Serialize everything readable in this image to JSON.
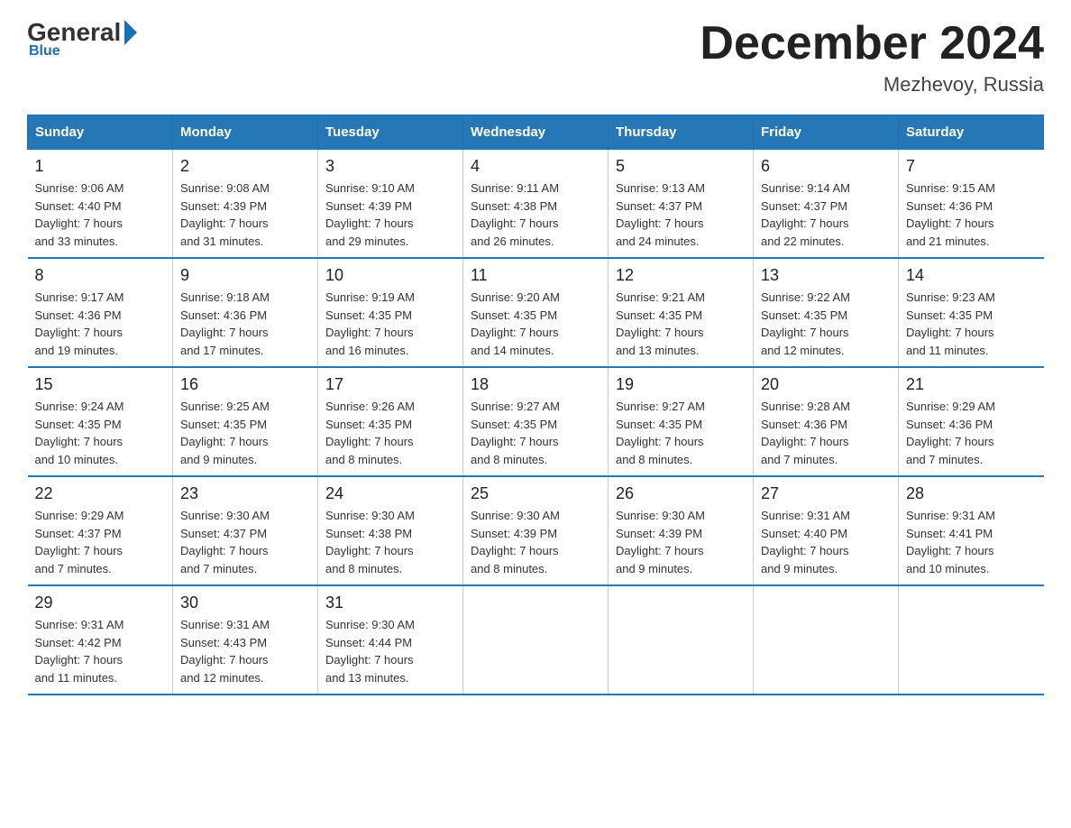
{
  "header": {
    "logo_general": "General",
    "logo_blue": "Blue",
    "title": "December 2024",
    "subtitle": "Mezhevoy, Russia"
  },
  "columns": [
    "Sunday",
    "Monday",
    "Tuesday",
    "Wednesday",
    "Thursday",
    "Friday",
    "Saturday"
  ],
  "weeks": [
    [
      {
        "day": "1",
        "info": "Sunrise: 9:06 AM\nSunset: 4:40 PM\nDaylight: 7 hours\nand 33 minutes."
      },
      {
        "day": "2",
        "info": "Sunrise: 9:08 AM\nSunset: 4:39 PM\nDaylight: 7 hours\nand 31 minutes."
      },
      {
        "day": "3",
        "info": "Sunrise: 9:10 AM\nSunset: 4:39 PM\nDaylight: 7 hours\nand 29 minutes."
      },
      {
        "day": "4",
        "info": "Sunrise: 9:11 AM\nSunset: 4:38 PM\nDaylight: 7 hours\nand 26 minutes."
      },
      {
        "day": "5",
        "info": "Sunrise: 9:13 AM\nSunset: 4:37 PM\nDaylight: 7 hours\nand 24 minutes."
      },
      {
        "day": "6",
        "info": "Sunrise: 9:14 AM\nSunset: 4:37 PM\nDaylight: 7 hours\nand 22 minutes."
      },
      {
        "day": "7",
        "info": "Sunrise: 9:15 AM\nSunset: 4:36 PM\nDaylight: 7 hours\nand 21 minutes."
      }
    ],
    [
      {
        "day": "8",
        "info": "Sunrise: 9:17 AM\nSunset: 4:36 PM\nDaylight: 7 hours\nand 19 minutes."
      },
      {
        "day": "9",
        "info": "Sunrise: 9:18 AM\nSunset: 4:36 PM\nDaylight: 7 hours\nand 17 minutes."
      },
      {
        "day": "10",
        "info": "Sunrise: 9:19 AM\nSunset: 4:35 PM\nDaylight: 7 hours\nand 16 minutes."
      },
      {
        "day": "11",
        "info": "Sunrise: 9:20 AM\nSunset: 4:35 PM\nDaylight: 7 hours\nand 14 minutes."
      },
      {
        "day": "12",
        "info": "Sunrise: 9:21 AM\nSunset: 4:35 PM\nDaylight: 7 hours\nand 13 minutes."
      },
      {
        "day": "13",
        "info": "Sunrise: 9:22 AM\nSunset: 4:35 PM\nDaylight: 7 hours\nand 12 minutes."
      },
      {
        "day": "14",
        "info": "Sunrise: 9:23 AM\nSunset: 4:35 PM\nDaylight: 7 hours\nand 11 minutes."
      }
    ],
    [
      {
        "day": "15",
        "info": "Sunrise: 9:24 AM\nSunset: 4:35 PM\nDaylight: 7 hours\nand 10 minutes."
      },
      {
        "day": "16",
        "info": "Sunrise: 9:25 AM\nSunset: 4:35 PM\nDaylight: 7 hours\nand 9 minutes."
      },
      {
        "day": "17",
        "info": "Sunrise: 9:26 AM\nSunset: 4:35 PM\nDaylight: 7 hours\nand 8 minutes."
      },
      {
        "day": "18",
        "info": "Sunrise: 9:27 AM\nSunset: 4:35 PM\nDaylight: 7 hours\nand 8 minutes."
      },
      {
        "day": "19",
        "info": "Sunrise: 9:27 AM\nSunset: 4:35 PM\nDaylight: 7 hours\nand 8 minutes."
      },
      {
        "day": "20",
        "info": "Sunrise: 9:28 AM\nSunset: 4:36 PM\nDaylight: 7 hours\nand 7 minutes."
      },
      {
        "day": "21",
        "info": "Sunrise: 9:29 AM\nSunset: 4:36 PM\nDaylight: 7 hours\nand 7 minutes."
      }
    ],
    [
      {
        "day": "22",
        "info": "Sunrise: 9:29 AM\nSunset: 4:37 PM\nDaylight: 7 hours\nand 7 minutes."
      },
      {
        "day": "23",
        "info": "Sunrise: 9:30 AM\nSunset: 4:37 PM\nDaylight: 7 hours\nand 7 minutes."
      },
      {
        "day": "24",
        "info": "Sunrise: 9:30 AM\nSunset: 4:38 PM\nDaylight: 7 hours\nand 8 minutes."
      },
      {
        "day": "25",
        "info": "Sunrise: 9:30 AM\nSunset: 4:39 PM\nDaylight: 7 hours\nand 8 minutes."
      },
      {
        "day": "26",
        "info": "Sunrise: 9:30 AM\nSunset: 4:39 PM\nDaylight: 7 hours\nand 9 minutes."
      },
      {
        "day": "27",
        "info": "Sunrise: 9:31 AM\nSunset: 4:40 PM\nDaylight: 7 hours\nand 9 minutes."
      },
      {
        "day": "28",
        "info": "Sunrise: 9:31 AM\nSunset: 4:41 PM\nDaylight: 7 hours\nand 10 minutes."
      }
    ],
    [
      {
        "day": "29",
        "info": "Sunrise: 9:31 AM\nSunset: 4:42 PM\nDaylight: 7 hours\nand 11 minutes."
      },
      {
        "day": "30",
        "info": "Sunrise: 9:31 AM\nSunset: 4:43 PM\nDaylight: 7 hours\nand 12 minutes."
      },
      {
        "day": "31",
        "info": "Sunrise: 9:30 AM\nSunset: 4:44 PM\nDaylight: 7 hours\nand 13 minutes."
      },
      {
        "day": "",
        "info": ""
      },
      {
        "day": "",
        "info": ""
      },
      {
        "day": "",
        "info": ""
      },
      {
        "day": "",
        "info": ""
      }
    ]
  ]
}
